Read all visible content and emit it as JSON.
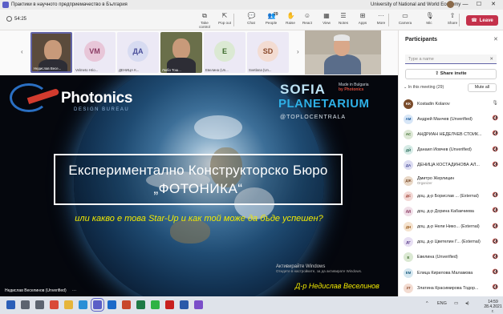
{
  "window": {
    "title": "Практики в научното предприемачество в България",
    "org": "University of National and World Economy",
    "min": "—",
    "max": "☐",
    "close": "✕"
  },
  "toolbar": {
    "timer": "54:25",
    "buttons": [
      {
        "label": "Take control",
        "icon": "⧉"
      },
      {
        "label": "Pop out",
        "icon": "⇱"
      },
      {
        "label": "Chat",
        "icon": "💬"
      },
      {
        "label": "People",
        "icon": "👥",
        "badge": "29"
      },
      {
        "label": "Raise",
        "icon": "✋"
      },
      {
        "label": "React",
        "icon": "☺"
      },
      {
        "label": "View",
        "icon": "▦"
      },
      {
        "label": "Notes",
        "icon": "☰"
      },
      {
        "label": "Apps",
        "icon": "⊞"
      },
      {
        "label": "More",
        "icon": "···"
      },
      {
        "label": "Camera",
        "icon": "▭"
      },
      {
        "label": "Mic",
        "icon": "🎙"
      },
      {
        "label": "Share",
        "icon": "⇧"
      }
    ],
    "leave_label": "Leave"
  },
  "strip": {
    "left_arrow": "‹",
    "right_arrow": "›",
    "tiles": [
      {
        "name": "Недислав Весе...",
        "initials": "",
        "video": true,
        "color": "#5b4b3c"
      },
      {
        "name": "Velmeto Hrio...",
        "initials": "VM",
        "video": false,
        "color": "#e8c6d8",
        "fg": "#8a3a62"
      },
      {
        "name": "ДЕНИЦА К...",
        "initials": "ДА",
        "video": false,
        "color": "#d7dbf1",
        "fg": "#4a4f9a"
      },
      {
        "name": "Любо Тош...",
        "initials": "",
        "video": true,
        "color": "#6a6f4a"
      },
      {
        "name": "Евелина (Un...",
        "initials": "E",
        "video": false,
        "color": "#dbe9d3",
        "fg": "#3d6b2c"
      },
      {
        "name": "Svetlana (Un...",
        "initials": "SD",
        "video": false,
        "color": "#f3dcd2",
        "fg": "#8a4a2c"
      }
    ]
  },
  "slide": {
    "brand": "Photonics",
    "brand_sub": "DESIGN BUREAU",
    "sp_made": "Made in Bulgaria",
    "sp_made2": "by Photonics",
    "sp_line1": "SOFIA",
    "sp_line2": "PLANETARIUM",
    "sp_handle": "@TOPLOCENTRALA",
    "title_line1": "Експериментално Конструкторско Бюро",
    "title_line2": "„ФОТОНИКА“",
    "subtitle": "или какво е това Star-Up и как той може да бъде успешен?",
    "activate_line1": "Активирайте Windows",
    "activate_line2": "Отидете в настройките, за да активирате Windows.",
    "author": "Д-р Недислав Веселинов"
  },
  "presenter_label": "Недислав Веселинов (Unverified)",
  "panel": {
    "title": "Participants",
    "close": "✕",
    "search_placeholder": "Type a name",
    "share_label": "Share invite",
    "in_meeting": "In this meeting (29)",
    "mute_all": "Mute all",
    "people": [
      {
        "name": "Kostadin Kolarov",
        "role": "",
        "initials": "KK",
        "bg": "#7a4b2a",
        "fg": "#ffffff",
        "mic": "🎙"
      },
      {
        "name": "Андрей Манчев (Unverified)",
        "role": "",
        "initials": "AM",
        "bg": "#d7e6f7",
        "fg": "#1a5a9a",
        "mic": "🔇"
      },
      {
        "name": "АНДРИАН НЕДЕЛЧЕВ СТОЙК...",
        "role": "",
        "initials": "AC",
        "bg": "#dde8d6",
        "fg": "#3d6b2c",
        "mic": "🔇"
      },
      {
        "name": "Данаил Йовчев (Unverified)",
        "role": "",
        "initials": "ДЙ",
        "bg": "#d6ebe6",
        "fg": "#2a6b5a",
        "mic": "🔇"
      },
      {
        "name": "ДЕНИЦА КОСТАДИНОВА АЛ...",
        "role": "",
        "initials": "ДА",
        "bg": "#dcdcf2",
        "fg": "#4a4f9a",
        "mic": "🔇"
      },
      {
        "name": "Дмитро Жерлицин",
        "role": "Organizer",
        "initials": "ДЖ",
        "bg": "#e9d8c7",
        "fg": "#7a4b2a",
        "mic": ""
      },
      {
        "name": "доц. д-р Борислав ... (External)",
        "role": "",
        "initials": "ДС",
        "bg": "#f3d9d6",
        "fg": "#9a3a2e",
        "mic": "🔇"
      },
      {
        "name": "доц. д-р Дорина Кабакчиева",
        "role": "",
        "initials": "ДД",
        "bg": "#f0dfe8",
        "fg": "#8a3a62",
        "mic": "🔇"
      },
      {
        "name": "доц. д-р Нели Нико... (External)",
        "role": "",
        "initials": "ДН",
        "bg": "#f5e3cf",
        "fg": "#9a5a1a",
        "mic": "🔇"
      },
      {
        "name": "доц. д-р Цветелин Г... (External)",
        "role": "",
        "initials": "ДГ",
        "bg": "#e7dff3",
        "fg": "#5a3d8a",
        "mic": "🔇"
      },
      {
        "name": "Евелина (Unverified)",
        "role": "",
        "initials": "E",
        "bg": "#dbe9d3",
        "fg": "#3d6b2c",
        "mic": "🔇"
      },
      {
        "name": "Елица Кирилова Маламова",
        "role": "",
        "initials": "EM",
        "bg": "#d5e7f0",
        "fg": "#1f5f80",
        "mic": "🔇"
      },
      {
        "name": "Златина Красимирова Тодор...",
        "role": "",
        "initials": "ЗТ",
        "bg": "#f3dcd2",
        "fg": "#8a4a2c",
        "mic": "🔇"
      }
    ]
  },
  "taskbar": {
    "lang": "ENG",
    "time": "14:59",
    "date": "28.4.2021 г.",
    "icons": [
      {
        "name": "start-icon",
        "color": "#2b5fb8"
      },
      {
        "name": "search-icon",
        "color": "#5d6470"
      },
      {
        "name": "task-view-icon",
        "color": "#5d6470"
      },
      {
        "name": "chrome-icon",
        "color": "#d94a38"
      },
      {
        "name": "explorer-icon",
        "color": "#e6b53a"
      },
      {
        "name": "edge-icon",
        "color": "#2a8fd6"
      },
      {
        "name": "teams-icon",
        "color": "#5b5fc7"
      },
      {
        "name": "outlook-icon",
        "color": "#1b6ac9"
      },
      {
        "name": "powerpoint-icon",
        "color": "#c8472b"
      },
      {
        "name": "excel-icon",
        "color": "#1e7a45"
      },
      {
        "name": "whatsapp-icon",
        "color": "#2fb344"
      },
      {
        "name": "acrobat-icon",
        "color": "#c8201e"
      },
      {
        "name": "word-icon",
        "color": "#2a5aa9"
      },
      {
        "name": "viber-icon",
        "color": "#7b4fc9"
      }
    ]
  }
}
